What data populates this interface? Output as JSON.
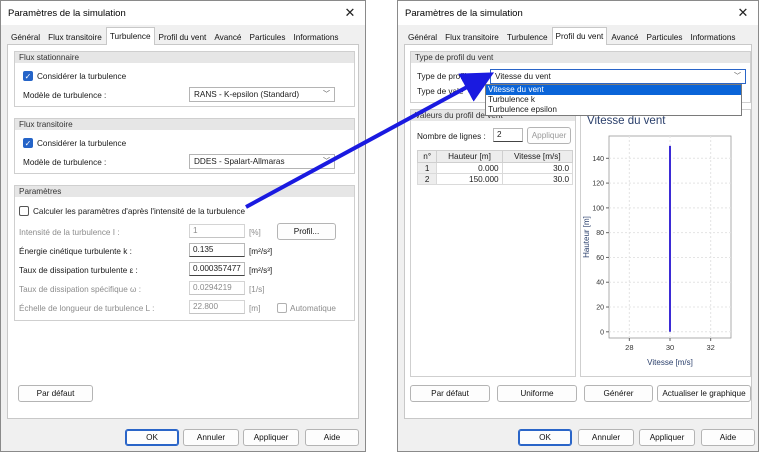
{
  "left_window": {
    "title": "Paramètres de la simulation",
    "tabs": [
      "Général",
      "Flux transitoire",
      "Turbulence",
      "Profil du vent",
      "Avancé",
      "Particules",
      "Informations"
    ],
    "active_tab": "Turbulence",
    "steady": {
      "header": "Flux stationnaire",
      "consider_label": "Considérer la turbulence",
      "consider_checked": true,
      "model_label": "Modèle de turbulence :",
      "model_value": "RANS - K-epsilon (Standard)"
    },
    "transient": {
      "header": "Flux transitoire",
      "consider_label": "Considérer la turbulence",
      "consider_checked": true,
      "model_label": "Modèle de turbulence :",
      "model_value": "DDES - Spalart-Allmaras"
    },
    "params": {
      "header": "Paramètres",
      "calc_label": "Calculer les paramètres d'après l'intensité de la turbulence",
      "calc_checked": false,
      "intensity": {
        "label": "Intensité de la turbulence I :",
        "value": "1",
        "unit": "[%]"
      },
      "profile_button": "Profil...",
      "energy": {
        "label": "Énergie cinétique turbulente k :",
        "value": "0.135",
        "unit": "[m²/s²]"
      },
      "dissipation": {
        "label": "Taux de dissipation turbulente ε :",
        "value": "0.000357477",
        "unit": "[m²/s³]"
      },
      "specific": {
        "label": "Taux de dissipation spécifique ω :",
        "value": "0.0294219",
        "unit": "[1/s]"
      },
      "length": {
        "label": "Échelle de longueur de turbulence L :",
        "value": "22.800",
        "unit": "[m]"
      },
      "auto_label": "Automatique"
    },
    "default_button": "Par défaut",
    "footer": {
      "ok": "OK",
      "cancel": "Annuler",
      "apply": "Appliquer",
      "help": "Aide"
    }
  },
  "right_window": {
    "title": "Paramètres de la simulation",
    "tabs": [
      "Général",
      "Flux transitoire",
      "Turbulence",
      "Profil du vent",
      "Avancé",
      "Particules",
      "Informations"
    ],
    "active_tab": "Profil du vent",
    "profile_type_group": {
      "header": "Type de profil du vent",
      "type_label": "Type de profil :",
      "type_value": "Vitesse du vent",
      "value_label": "Type de vale",
      "dropdown_options": [
        "Vitesse du vent",
        "Turbulence k",
        "Turbulence epsilon"
      ],
      "dropdown_selected": 0
    },
    "values_group": {
      "header": "Valeurs du profil de vent",
      "rows_label": "Nombre de lignes :",
      "rows_value": "2",
      "apply_button": "Appliquer",
      "columns": [
        "n°",
        "Hauteur [m]",
        "Vitesse [m/s]"
      ],
      "rows": [
        [
          "1",
          "0.000",
          "30.0"
        ],
        [
          "2",
          "150.000",
          "30.0"
        ]
      ]
    },
    "chart_title": "Vitesse du vent",
    "buttons": {
      "default": "Par défaut",
      "uniform": "Uniforme",
      "generate": "Générer",
      "refresh": "Actualiser le graphique"
    },
    "footer": {
      "ok": "OK",
      "cancel": "Annuler",
      "apply": "Appliquer",
      "help": "Aide"
    }
  },
  "chart_data": {
    "type": "line",
    "title": "Vitesse du vent",
    "xlabel": "Vitesse [m/s]",
    "ylabel": "Hauteur [m]",
    "xlim": [
      27,
      33
    ],
    "ylim": [
      -5,
      158
    ],
    "xticks": [
      28,
      30,
      32
    ],
    "yticks": [
      0,
      20,
      40,
      60,
      80,
      100,
      120,
      140
    ],
    "grid": true,
    "series": [
      {
        "x": [
          30.0,
          30.0
        ],
        "y": [
          0.0,
          150.0
        ],
        "color": "#3b2bd6"
      }
    ]
  },
  "colors": {
    "accent": "#2564c8",
    "arrow": "#1a1ae0",
    "series": "#3b2bd6"
  }
}
